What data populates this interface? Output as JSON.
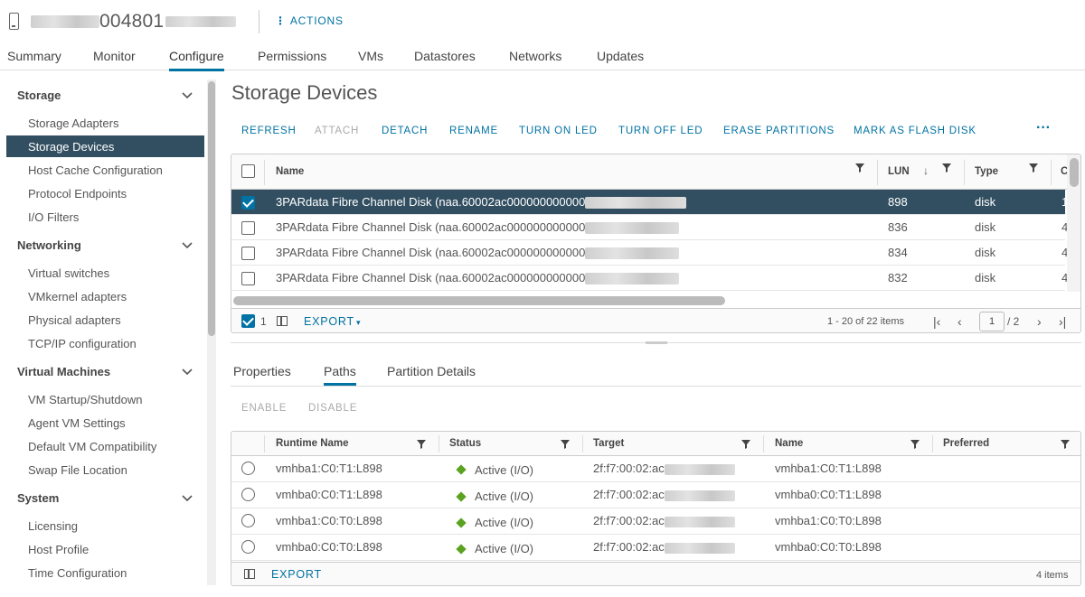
{
  "header": {
    "host_name": "004801",
    "actions_label": "ACTIONS"
  },
  "tabs": [
    {
      "label": "Summary"
    },
    {
      "label": "Monitor"
    },
    {
      "label": "Configure"
    },
    {
      "label": "Permissions"
    },
    {
      "label": "VMs"
    },
    {
      "label": "Datastores"
    },
    {
      "label": "Networks"
    },
    {
      "label": "Updates"
    }
  ],
  "sidebar": {
    "storage": {
      "title": "Storage",
      "items": [
        "Storage Adapters",
        "Storage Devices",
        "Host Cache Configuration",
        "Protocol Endpoints",
        "I/O Filters"
      ]
    },
    "networking": {
      "title": "Networking",
      "items": [
        "Virtual switches",
        "VMkernel adapters",
        "Physical adapters",
        "TCP/IP configuration"
      ]
    },
    "virtual_machines": {
      "title": "Virtual Machines",
      "items": [
        "VM Startup/Shutdown",
        "Agent VM Settings",
        "Default VM Compatibility",
        "Swap File Location"
      ]
    },
    "system": {
      "title": "System",
      "items": [
        "Licensing",
        "Host Profile",
        "Time Configuration"
      ]
    }
  },
  "main": {
    "title": "Storage Devices",
    "toolbar": {
      "refresh": "REFRESH",
      "attach": "ATTACH",
      "detach": "DETACH",
      "rename": "RENAME",
      "turn_on_led": "TURN ON LED",
      "turn_off_led": "TURN OFF LED",
      "erase_partitions": "ERASE PARTITIONS",
      "mark_flash": "MARK AS FLASH DISK",
      "more": "···"
    },
    "devices_grid": {
      "columns": {
        "name": "Name",
        "lun": "LUN",
        "type": "Type",
        "next": "C"
      },
      "rows": [
        {
          "name": "3PARdata Fibre Channel Disk (naa.60002ac000000000000",
          "lun": "898",
          "type": "disk",
          "extra": "1",
          "selected": true
        },
        {
          "name": "3PARdata Fibre Channel Disk (naa.60002ac000000000000",
          "lun": "836",
          "type": "disk",
          "extra": "4",
          "selected": false
        },
        {
          "name": "3PARdata Fibre Channel Disk (naa.60002ac000000000000",
          "lun": "834",
          "type": "disk",
          "extra": "4",
          "selected": false
        },
        {
          "name": "3PARdata Fibre Channel Disk (naa.60002ac000000000000",
          "lun": "832",
          "type": "disk",
          "extra": "4",
          "selected": false
        }
      ],
      "footer": {
        "selected_count": "1",
        "export": "EXPORT",
        "range": "1 - 20 of 22 items",
        "page": "1",
        "page_total": "/ 2"
      }
    },
    "detail_tabs": [
      {
        "label": "Properties"
      },
      {
        "label": "Paths"
      },
      {
        "label": "Partition Details"
      }
    ],
    "paths_toolbar": {
      "enable": "ENABLE",
      "disable": "DISABLE"
    },
    "paths_grid": {
      "columns": {
        "runtime": "Runtime Name",
        "status": "Status",
        "target": "Target",
        "name": "Name",
        "preferred": "Preferred"
      },
      "rows": [
        {
          "runtime": "vmhba1:C0:T1:L898",
          "status": "Active (I/O)",
          "target": "2f:f7:00:02:ac",
          "name": "vmhba1:C0:T1:L898"
        },
        {
          "runtime": "vmhba0:C0:T1:L898",
          "status": "Active (I/O)",
          "target": "2f:f7:00:02:ac",
          "name": "vmhba0:C0:T1:L898"
        },
        {
          "runtime": "vmhba1:C0:T0:L898",
          "status": "Active (I/O)",
          "target": "2f:f7:00:02:ac",
          "name": "vmhba1:C0:T0:L898"
        },
        {
          "runtime": "vmhba0:C0:T0:L898",
          "status": "Active (I/O)",
          "target": "2f:f7:00:02:ac",
          "name": "vmhba0:C0:T0:L898"
        }
      ],
      "footer": {
        "export": "EXPORT",
        "count": "4 items"
      }
    }
  },
  "colors": {
    "accent": "#0072a3",
    "selected_row": "#324f61",
    "status_active": "#5aa220"
  }
}
